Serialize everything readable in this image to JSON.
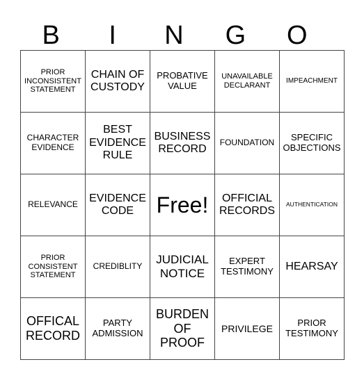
{
  "header": {
    "letters": [
      "B",
      "I",
      "N",
      "G",
      "O"
    ]
  },
  "grid": {
    "rows": [
      [
        "PRIOR INCONSISTENT STATEMENT",
        "CHAIN OF CUSTODY",
        "PROBATIVE VALUE",
        "UNAVAILABLE DECLARANT",
        "IMPEACHMENT"
      ],
      [
        "CHARACTER EVIDENCE",
        "BEST EVIDENCE RULE",
        "BUSINESS RECORD",
        "FOUNDATION",
        "SPECIFIC OBJECTIONS"
      ],
      [
        "RELEVANCE",
        "EVIDENCE CODE",
        "Free!",
        "OFFICIAL RECORDS",
        "AUTHENTICATION"
      ],
      [
        "PRIOR CONSISTENT STATEMENT",
        "CREDIBLITY",
        "JUDICIAL NOTICE",
        "EXPERT TESTIMONY",
        "HEARSAY"
      ],
      [
        "OFFICAL RECORD",
        "PARTY ADMISSION",
        "BURDEN OF PROOF",
        "PRIVILEGE",
        "PRIOR TESTIMONY"
      ]
    ]
  }
}
